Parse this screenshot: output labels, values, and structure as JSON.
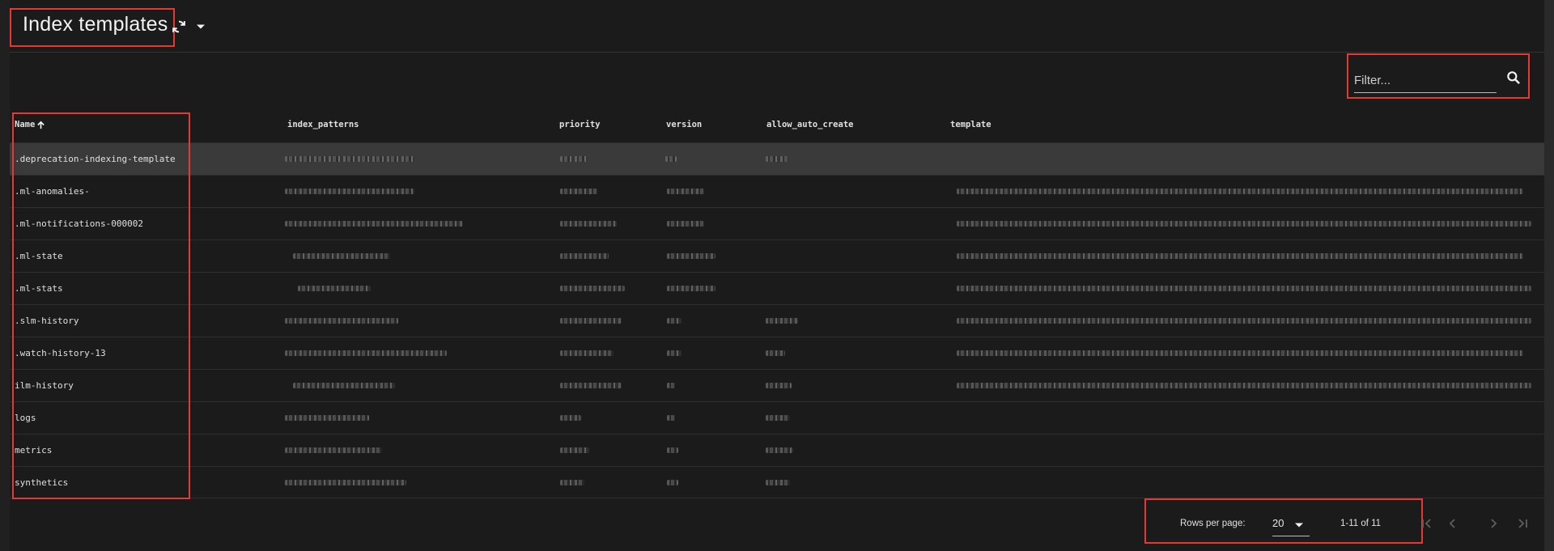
{
  "header": {
    "title": "Index templates"
  },
  "filter": {
    "placeholder": "Filter..."
  },
  "table": {
    "columns": [
      {
        "key": "name",
        "label": "Name"
      },
      {
        "key": "index_patterns",
        "label": "index_patterns"
      },
      {
        "key": "priority",
        "label": "priority"
      },
      {
        "key": "version",
        "label": "version"
      },
      {
        "key": "allow_auto_create",
        "label": "allow_auto_create"
      },
      {
        "key": "template",
        "label": "template"
      }
    ],
    "sort_icon": "arrow-up-icon",
    "rows": [
      {
        "name": ".deprecation-indexing-template"
      },
      {
        "name": ".ml-anomalies-"
      },
      {
        "name": ".ml-notifications-000002"
      },
      {
        "name": ".ml-state"
      },
      {
        "name": ".ml-stats"
      },
      {
        "name": ".slm-history"
      },
      {
        "name": ".watch-history-13"
      },
      {
        "name": "ilm-history"
      },
      {
        "name": "logs"
      },
      {
        "name": "metrics"
      },
      {
        "name": "synthetics"
      }
    ]
  },
  "pagination": {
    "rows_per_page_label": "Rows per page:",
    "rows_per_page_value": "20",
    "range": "1-11 of 11"
  },
  "icons": {
    "refresh": "refresh-icon",
    "dropdown": "caret-down-icon",
    "search": "search-icon",
    "first": "first-page-icon",
    "prev": "chevron-left-icon",
    "next": "chevron-right-icon",
    "last": "last-page-icon"
  },
  "colors": {
    "background": "#1b1b1b",
    "selected_row": "#3a3a3a",
    "highlight_outline": "#e53935",
    "text": "#e0e0e0"
  }
}
